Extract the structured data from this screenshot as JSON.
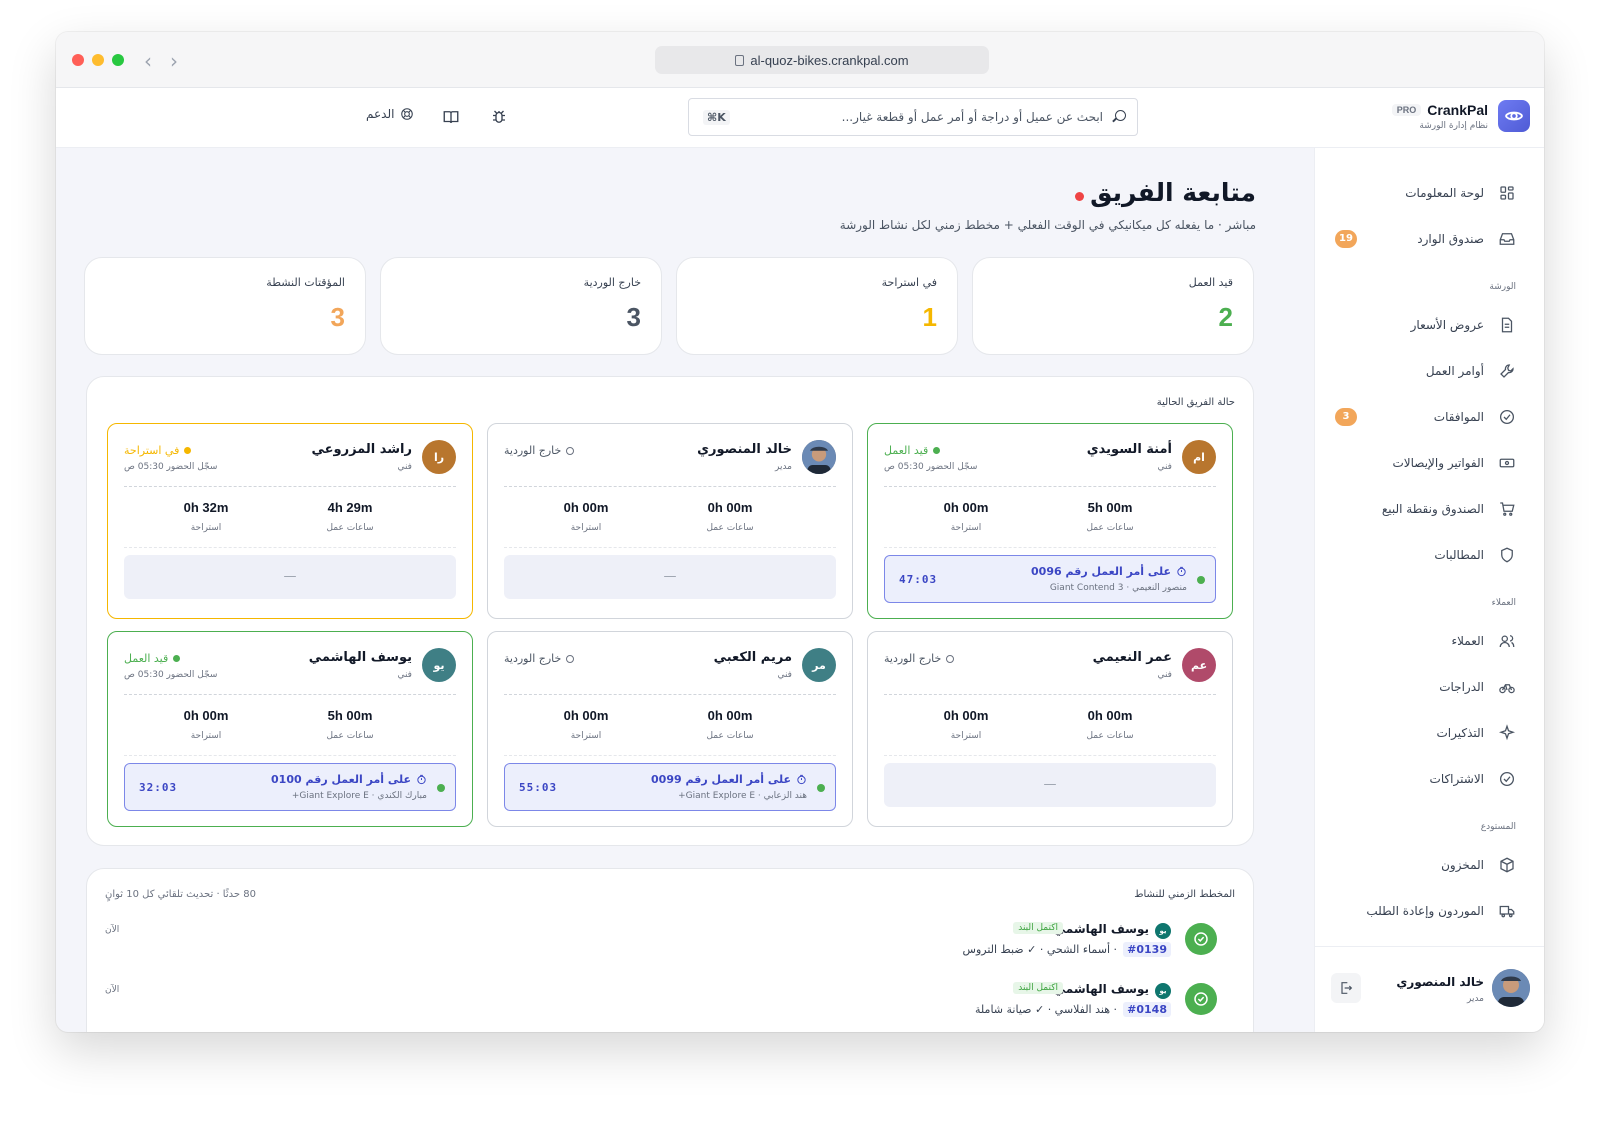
{
  "browser": {
    "url": "al-quoz-bikes.crankpal.com"
  },
  "topbar": {
    "search_placeholder": "ابحث عن عميل أو دراجة أو أمر عمل أو قطعة غيار...",
    "search_shortcut": "⌘K",
    "support_label": "الدعم"
  },
  "brand": {
    "name": "CrankPal",
    "tier": "PRO",
    "tagline": "نظام إدارة الورشة"
  },
  "sidebar": {
    "items_top": [
      {
        "label": "لوحة المعلومات",
        "icon": "grid-icon"
      },
      {
        "label": "صندوق الوارد",
        "icon": "inbox-icon",
        "badge": "19"
      }
    ],
    "section_workshop": "الورشة",
    "items_workshop": [
      {
        "label": "عروض الأسعار",
        "icon": "document-icon"
      },
      {
        "label": "أوامر العمل",
        "icon": "wrench-icon"
      },
      {
        "label": "الموافقات",
        "icon": "check-circle-icon",
        "badge": "3"
      },
      {
        "label": "الفواتير والإيصالات",
        "icon": "banknote-icon"
      },
      {
        "label": "الصندوق ونقطة البيع",
        "icon": "cart-icon"
      },
      {
        "label": "المطالبات",
        "icon": "shield-icon"
      }
    ],
    "section_customers": "العملاء",
    "items_customers": [
      {
        "label": "العملاء",
        "icon": "users-icon"
      },
      {
        "label": "الدراجات",
        "icon": "bike-icon"
      },
      {
        "label": "التذكيرات",
        "icon": "sparkle-icon"
      },
      {
        "label": "الاشتراكات",
        "icon": "check-circle-icon"
      }
    ],
    "section_warehouse": "المستودع",
    "items_warehouse": [
      {
        "label": "المخزون",
        "icon": "box-icon"
      },
      {
        "label": "الموردون وإعادة الطلب",
        "icon": "truck-icon"
      }
    ],
    "profile": {
      "name": "خالد المنصوري",
      "role": "مدير"
    }
  },
  "page": {
    "title": "متابعة الفريق",
    "subtitle": "مباشر · ما يفعله كل ميكانيكي في الوقت الفعلي + مخطط زمني لكل نشاط الورشة"
  },
  "stats": [
    {
      "label": "قيد العمل",
      "value": "2",
      "color": "#4caf50"
    },
    {
      "label": "في استراحة",
      "value": "1",
      "color": "#f5b700"
    },
    {
      "label": "خارج الوردية",
      "value": "3",
      "color": "#4b5563"
    },
    {
      "label": "المؤقتات النشطة",
      "value": "3",
      "color": "#f2a65a"
    }
  ],
  "team": {
    "title": "حالة الفريق الحالية",
    "work_hours_label": "ساعات عمل",
    "break_label": "استراحة",
    "members": [
      {
        "initials": "ام",
        "avatar_color": "#b8762e",
        "name": "أمنة السويدي",
        "role": "فني",
        "status": "قيد العمل",
        "status_color": "#4caf50",
        "checkin": "سجّل الحضور 05:30 ص",
        "work": "5h 00m",
        "break": "0h 00m",
        "job_title": "على أمر العمل رقم 0096",
        "job_sub": "منصور النعيمي · Giant Contend 3",
        "job_time": "47:03"
      },
      {
        "initials": "",
        "avatar_color": "#4b5563",
        "name": "خالد المنصوري",
        "role": "مدير",
        "status": "خارج الوردية",
        "status_color": "#6b7280",
        "checkin": "",
        "work": "0h 00m",
        "break": "0h 00m",
        "empty": "—"
      },
      {
        "initials": "را",
        "avatar_color": "#b8762e",
        "name": "راشد المزروعي",
        "role": "فني",
        "status": "في استراحة",
        "status_color": "#f5b700",
        "checkin": "سجّل الحضور 05:30 ص",
        "work": "4h 29m",
        "break": "0h 32m",
        "empty": "—"
      },
      {
        "initials": "عم",
        "avatar_color": "#b04a6a",
        "name": "عمر النعيمي",
        "role": "فني",
        "status": "خارج الوردية",
        "status_color": "#6b7280",
        "checkin": "",
        "work": "0h 00m",
        "break": "0h 00m",
        "empty": "—"
      },
      {
        "initials": "مر",
        "avatar_color": "#3f7f85",
        "name": "مريم الكعبي",
        "role": "فني",
        "status": "خارج الوردية",
        "status_color": "#6b7280",
        "checkin": "",
        "work": "0h 00m",
        "break": "0h 00m",
        "job_title": "على أمر العمل رقم 0099",
        "job_sub": "هند الزعابي · Giant Explore E+",
        "job_time": "55:03"
      },
      {
        "initials": "يو",
        "avatar_color": "#3f7f85",
        "name": "يوسف الهاشمي",
        "role": "فني",
        "status": "قيد العمل",
        "status_color": "#4caf50",
        "checkin": "سجّل الحضور 05:30 ص",
        "work": "5h 00m",
        "break": "0h 00m",
        "job_title": "على أمر العمل رقم 0100",
        "job_sub": "مبارك الكندي · Giant Explore E+",
        "job_time": "32:03"
      }
    ]
  },
  "timeline": {
    "title": "المخطط الزمني للنشاط",
    "meta": "80 حدثًا · تحديث تلقائي كل 10 ثوانٍ",
    "events": [
      {
        "initials": "يو",
        "name": "يوسف الهاشمي",
        "tag": "اكتمل البند",
        "order": "#0139",
        "desc": "· أسماء الشحي · ✓ ضبط التروس",
        "time": "الآن"
      },
      {
        "initials": "يو",
        "name": "يوسف الهاشمي",
        "tag": "اكتمل البند",
        "order": "#0148",
        "desc": "· هند الفلاسي · ✓ صيانة شاملة",
        "time": "الآن"
      }
    ]
  }
}
